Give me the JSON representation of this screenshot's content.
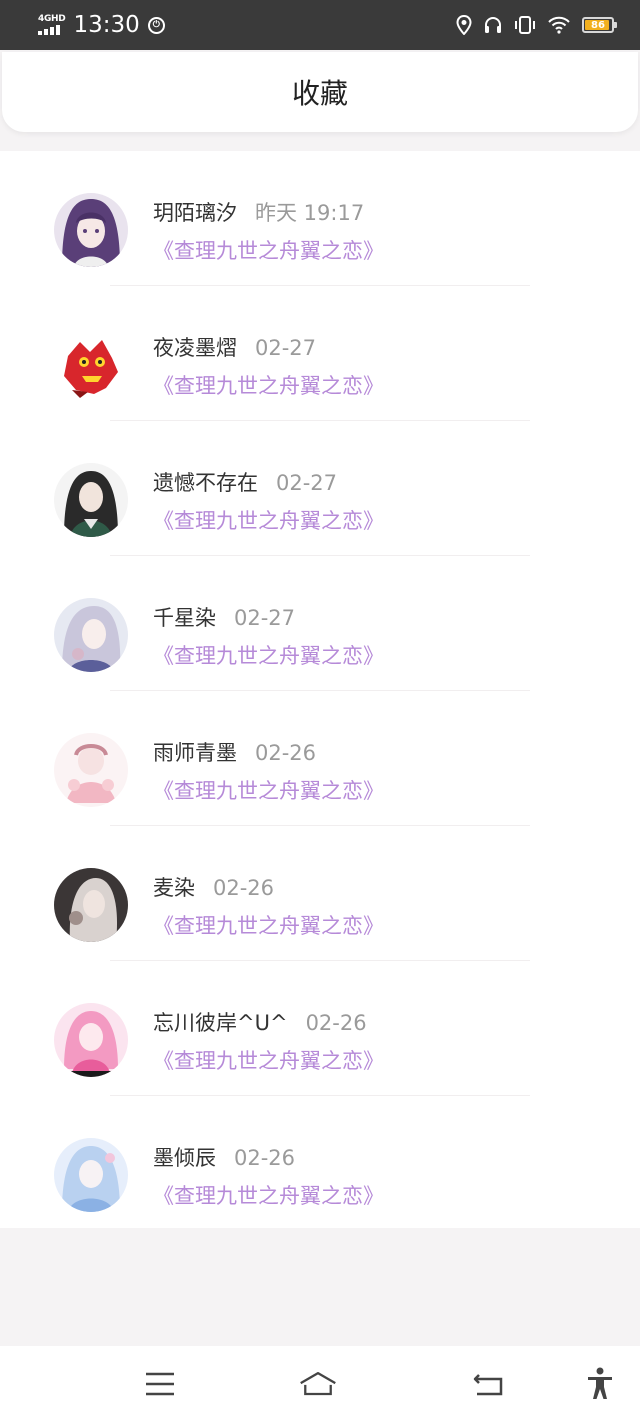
{
  "status_bar": {
    "network": "4GHD",
    "time": "13:30",
    "battery": "86",
    "icons": [
      "signal-icon",
      "vpn-icon",
      "location-icon",
      "headphones-icon",
      "vibrate-icon",
      "wifi-icon",
      "battery-icon"
    ]
  },
  "header": {
    "title": "收藏"
  },
  "favorites": [
    {
      "name": "玥陌璃汐",
      "time": "昨天 19:17",
      "work": "《查理九世之舟翼之恋》"
    },
    {
      "name": "夜凌墨熠",
      "time": "02-27",
      "work": "《查理九世之舟翼之恋》"
    },
    {
      "name": "遗憾不存在",
      "time": "02-27",
      "work": "《查理九世之舟翼之恋》"
    },
    {
      "name": "千星染",
      "time": "02-27",
      "work": "《查理九世之舟翼之恋》"
    },
    {
      "name": "雨师青墨",
      "time": "02-26",
      "work": "《查理九世之舟翼之恋》"
    },
    {
      "name": "麦染",
      "time": "02-26",
      "work": "《查理九世之舟翼之恋》"
    },
    {
      "name": "忘川彼岸^U^",
      "time": "02-26",
      "work": "《查理九世之舟翼之恋》"
    },
    {
      "name": "墨倾辰",
      "time": "02-26",
      "work": "《查理九世之舟翼之恋》"
    }
  ],
  "nav": [
    "menu-icon",
    "home-icon",
    "back-icon",
    "accessibility-icon"
  ],
  "colors": {
    "accent": "#b68ad8",
    "status_bar": "#3a3a3a",
    "battery": "#f2b01e"
  }
}
